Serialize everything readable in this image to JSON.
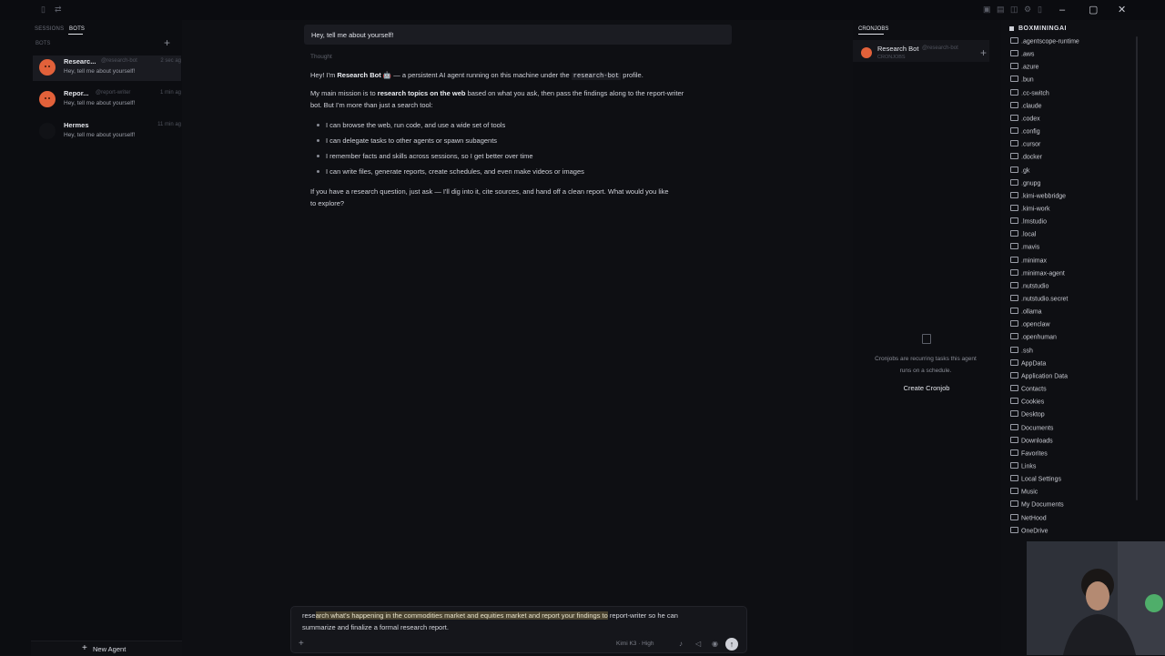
{
  "sidebar": {
    "tabs": [
      "SESSIONS",
      "BOTS"
    ],
    "section_label": "BOTS",
    "bots": [
      {
        "name": "Researc...",
        "handle": "@research-bot",
        "time": "2 sec ag",
        "message": "Hey, tell me about yourself!"
      },
      {
        "name": "Repor...",
        "handle": "@report-writer",
        "time": "1 min ag",
        "message": "Hey, tell me about yourself!"
      },
      {
        "name": "Hermes",
        "handle": "",
        "time": "11 min ag",
        "message": "Hey, tell me about yourself!"
      }
    ],
    "new_agent_label": "New Agent"
  },
  "chat": {
    "user_message": "Hey, tell me about yourself!",
    "thought_label": "Thought",
    "intro_pre": "Hey! I'm ",
    "intro_bold": "Research Bot",
    "intro_mid": " — a persistent AI agent running on this machine under the ",
    "intro_code": "research-bot",
    "intro_post": " profile.",
    "mission_pre": "My main mission is to ",
    "mission_bold": "research topics on the web",
    "mission_post": " based on what you ask, then pass the findings along to the report-writer",
    "mission_line2": "bot. But I'm more than just a search tool:",
    "bullets": [
      "I can browse the web, run code, and use a wide set of tools",
      "I can delegate tasks to other agents or spawn subagents",
      "I remember facts and skills across sessions, so I get better over time",
      "I can write files, generate reports, create schedules, and even make videos or images"
    ],
    "closing_line1": "If you have a research question, just ask — I'll dig into it, cite sources, and hand off a clean report. What would you like",
    "closing_line2": "to explore?"
  },
  "input": {
    "text_pre": "rese",
    "text_highlight": "arch what's happening in the commodities market and equities market and report your findings to",
    "text_post": " report-writer so he can",
    "text_line2": "summarize and finalize a formal research report.",
    "model_label": "Kimi K3 · High"
  },
  "cronjobs": {
    "tab_label": "CRONJOBS",
    "bot_name": "Research Bot",
    "bot_handle": "@research-bot",
    "bot_sub": "CRONJOBS",
    "empty_line1": "Cronjobs are recurring tasks this agent",
    "empty_line2": "runs on a schedule.",
    "create_label": "Create Cronjob"
  },
  "file_tree": {
    "title": "BOXMININGAI",
    "items": [
      ".agentscope-runtime",
      ".aws",
      ".azure",
      ".bun",
      ".cc-switch",
      ".claude",
      ".codex",
      ".config",
      ".cursor",
      ".docker",
      ".gk",
      ".gnupg",
      ".kimi-webbridge",
      ".kimi-work",
      ".lmstudio",
      ".local",
      ".mavis",
      ".minimax",
      ".minimax-agent",
      ".nutstudio",
      ".nutstudio.secret",
      ".ollama",
      ".openclaw",
      ".openhuman",
      ".ssh",
      "AppData",
      "Application Data",
      "Contacts",
      "Cookies",
      "Desktop",
      "Documents",
      "Downloads",
      "Favorites",
      "Links",
      "Local Settings",
      "Music",
      "My Documents",
      "NetHood",
      "OneDrive"
    ]
  },
  "colors": {
    "accent_orange": "#e2613a",
    "background": "#0e0f13",
    "highlight": "#4a4330"
  }
}
